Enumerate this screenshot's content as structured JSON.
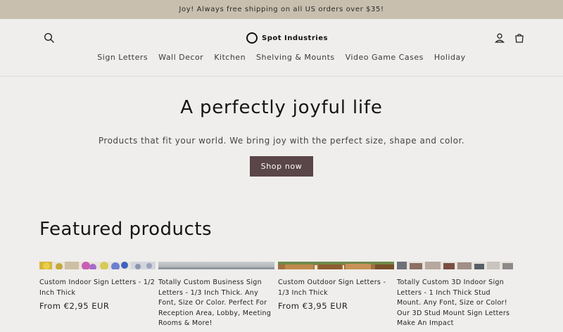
{
  "announcement": {
    "text": "Joy! Always free shipping on all US orders over $35!"
  },
  "header": {
    "logo_text": "Spot Industries",
    "icons": {
      "search": "search-icon",
      "account": "account-icon",
      "cart": "cart-icon"
    }
  },
  "nav": {
    "items": [
      {
        "label": "Sign Letters"
      },
      {
        "label": "Wall Decor"
      },
      {
        "label": "Kitchen"
      },
      {
        "label": "Shelving & Mounts"
      },
      {
        "label": "Video Game Cases"
      },
      {
        "label": "Holiday"
      }
    ]
  },
  "hero": {
    "title": "A perfectly joyful life",
    "subtitle": "Products that fit your world. We bring joy with the perfect size, shape and color.",
    "button_label": "Shop now"
  },
  "featured": {
    "title": "Featured products",
    "products": [
      {
        "title": "Custom Indoor Sign Letters - 1/2 Inch Thick",
        "price": "From €2,95 EUR"
      },
      {
        "title": "Totally Custom Business Sign Letters - 1/3 Inch Thick. Any Font, Size Or Color. Perfect For Reception Area, Lobby, Meeting Rooms & More!",
        "price": ""
      },
      {
        "title": "Custom Outdoor Sign Letters - 1/3 Inch Thick",
        "price": "From €3,95 EUR"
      },
      {
        "title": "Totally Custom 3D Indoor Sign Letters - 1 Inch Thick Stud Mount. Any Font, Size or Color! Our 3D Stud Mount Sign Letters Make An Impact",
        "price": ""
      }
    ]
  },
  "colors": {
    "announcement_bg": "#c8bfae",
    "page_bg": "#efeeec",
    "button_bg": "#5a4548"
  }
}
